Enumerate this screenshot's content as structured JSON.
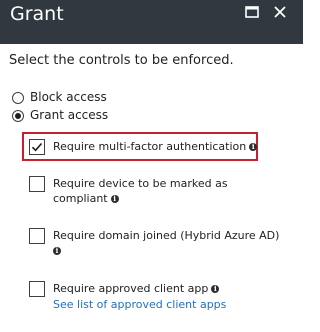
{
  "header": {
    "title": "Grant"
  },
  "instruction": "Select the controls to be enforced.",
  "access_options": [
    {
      "label": "Block access",
      "selected": false
    },
    {
      "label": "Grant access",
      "selected": true
    }
  ],
  "controls": [
    {
      "label": "Require multi-factor authentication",
      "checked": true,
      "highlighted": true
    },
    {
      "label_line1": "Require device to be marked as",
      "label_line2": "compliant",
      "checked": false
    },
    {
      "label": "Require domain joined (Hybrid Azure AD)",
      "checked": false
    },
    {
      "label": "Require approved client app",
      "checked": false,
      "link": "See list of approved client apps"
    }
  ],
  "icons": {
    "maximize": "maximize-icon",
    "close": "close-icon",
    "info": "info-icon"
  },
  "colors": {
    "header_bg": "#32383f",
    "highlight": "#c6202e",
    "link": "#1f6fbf"
  }
}
